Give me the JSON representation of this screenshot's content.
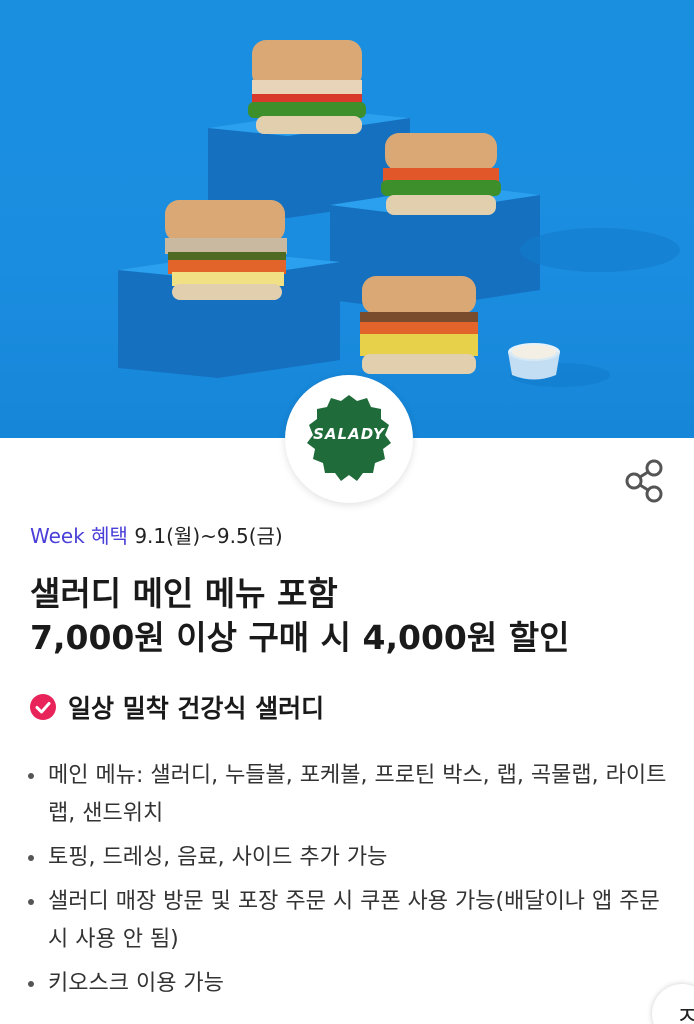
{
  "brand": {
    "logo_text": "SALADY",
    "logo_color": "#1f6b3a"
  },
  "promo": {
    "week_label": "Week 혜택",
    "week_dates": "9.1(월)~9.5(금)",
    "title_line1": "샐러디 메인 메뉴 포함",
    "title_line2": "7,000원 이상 구매 시 4,000원 할인",
    "feature": "일상 밀착 건강식 샐러디",
    "bullets": [
      "메인 메뉴: 샐러디, 누들볼, 포케볼, 프로틴 박스, 랩, 곡물랩, 라이트랩, 샌드위치",
      "토핑, 드레싱, 음료, 사이드 추가 가능",
      "샐러디 매장 방문 및 포장 주문 시 쿠폰 사용 가능(배달이나 앱 주문 시 사용 안 됨)",
      "키오스크 이용 가능"
    ]
  },
  "corner_button": {
    "label": "ㅈ"
  },
  "icons": {
    "share": "share-icon",
    "check": "check-circle-icon"
  },
  "colors": {
    "accent_purple": "#4a3fd8",
    "check_pink": "#e8245a",
    "hero_blue": "#1b8de0"
  }
}
